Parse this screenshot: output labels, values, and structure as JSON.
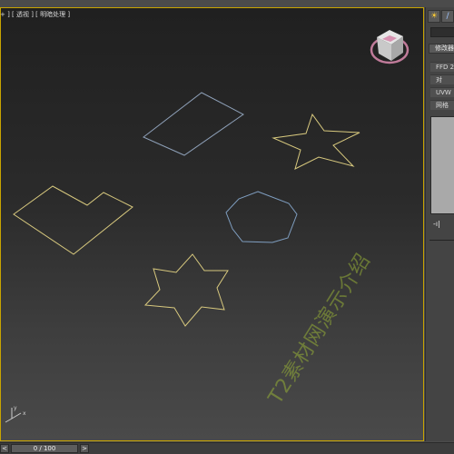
{
  "viewport": {
    "label": "+ ] [ 透视 ] [ 明暗处理 ]",
    "active_border": "#c8a400"
  },
  "colors": {
    "yellow_shape": "#d8c97e",
    "blue_shape": "#7f9ec0",
    "background_top": "#202020",
    "background_bottom": "#4a4a4a",
    "viewcube_ring": "#c07b9a"
  },
  "icons": {
    "viewcube": "viewcube-icon",
    "axis_tripod": "axis-tripod-icon",
    "create_tab": "sun-icon",
    "modify_tab": "curve-icon"
  },
  "command_panel": {
    "name_field": "",
    "modifier_list": "修改器",
    "items": [
      "FFD 2",
      "对",
      "UVW",
      "网格"
    ],
    "stack_controls": "-ı|"
  },
  "axis": {
    "x": "x",
    "y": "y"
  },
  "timeline": {
    "left_arrow": "<",
    "frame_display": "0 / 100",
    "right_arrow": ">"
  },
  "watermark": "T2素材网演示介绍"
}
